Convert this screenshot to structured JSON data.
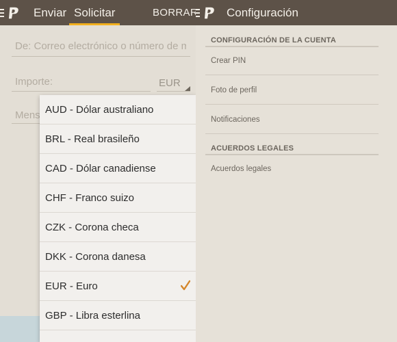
{
  "left": {
    "tabs": [
      {
        "label": "Enviar",
        "active": false
      },
      {
        "label": "Solicitar",
        "active": true
      }
    ],
    "clear_label": "BORRAR",
    "recipient_placeholder": "De: Correo electrónico o número de mó",
    "amount_placeholder": "Importe:",
    "currency": "EUR",
    "message_placeholder": "Mens",
    "currency_options": [
      {
        "label": "AUD - Dólar australiano",
        "selected": false
      },
      {
        "label": "BRL - Real brasileño",
        "selected": false
      },
      {
        "label": "CAD - Dólar canadiense",
        "selected": false
      },
      {
        "label": "CHF - Franco suizo",
        "selected": false
      },
      {
        "label": "CZK - Corona checa",
        "selected": false
      },
      {
        "label": "DKK - Corona danesa",
        "selected": false
      },
      {
        "label": "EUR - Euro",
        "selected": true
      },
      {
        "label": "GBP - Libra esterlina",
        "selected": false
      }
    ]
  },
  "right": {
    "title": "Configuración",
    "account_section": {
      "heading": "CONFIGURACIÓN DE LA CUENTA",
      "items": [
        "Crear PIN",
        "Foto de perfil",
        "Notificaciones"
      ]
    },
    "legal_section": {
      "heading": "ACUERDOS LEGALES",
      "items": [
        "Acuerdos legales"
      ]
    }
  },
  "colors": {
    "header": "#5d5248",
    "accent": "#f2b01e",
    "check": "#d4862a",
    "background": "#e3ded5"
  },
  "icons": [
    "menu-icon",
    "paypal-logo-icon",
    "check-icon"
  ]
}
